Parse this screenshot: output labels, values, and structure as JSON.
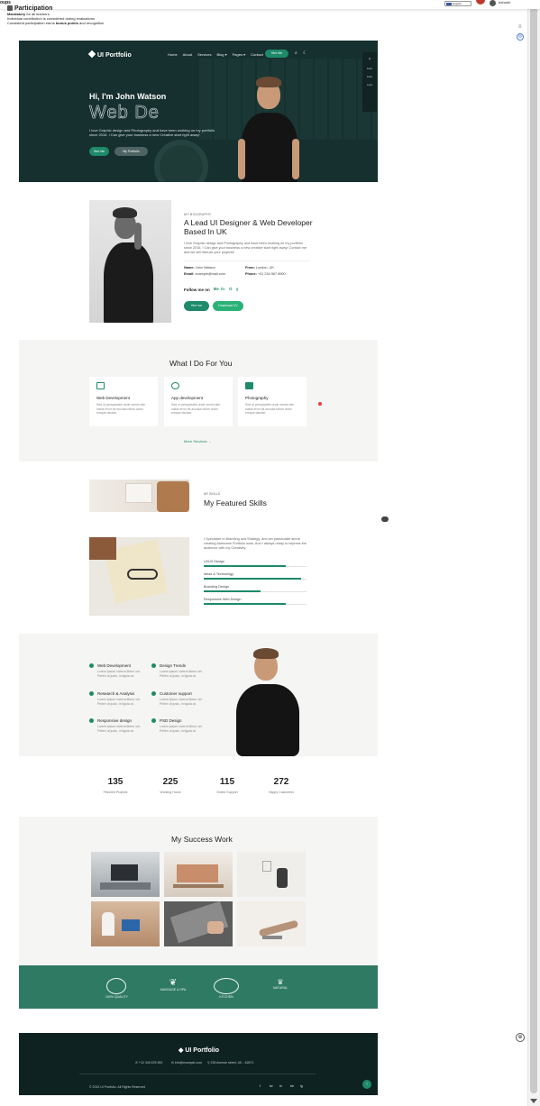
{
  "topbar": {
    "title": "oups",
    "language": "English",
    "user": "bahadir"
  },
  "intro": {
    "heading": "Participation",
    "line1_bold": "Mandatory",
    "line1_rest": " for all learners",
    "line2": "Individual contribution is considered during evaluations",
    "line3_pre": "Consistent participation earns ",
    "line3_bold": "bonus points",
    "line3_post": " and recognition"
  },
  "hero": {
    "brand": "UI Portfolio",
    "nav": [
      "Home",
      "About",
      "Services",
      "Blog",
      "Pages",
      "Contact"
    ],
    "hire_button": "Hire Me",
    "side_labels": [
      "Dark",
      "Dark",
      "Light"
    ],
    "greeting": "Hi, I'm John Watson",
    "role": "Web De",
    "description": "I love Graphic design and Photography and have been working on my portfolio since 2016. I Can give your business a new Creative start right away!",
    "btn_hire": "Hire Me",
    "btn_portfolio": "My Portfolio"
  },
  "about": {
    "small": "MY BIOGRAPHY",
    "title": "A Lead UI Designer & Web Developer Based In UK",
    "description": "I love Graphic design and Photography and have been working on my portfolio since 2016. I Can give your business a new creative start right away! Contact me and we will discuss your projects!",
    "name_label": "Name:",
    "name_value": "John Watson",
    "from_label": "From:",
    "from_value": "London, UK",
    "email_label": "Email:",
    "email_value": "example@mail.com",
    "phone_label": "Phone:",
    "phone_value": "+01 234 567 8900",
    "follow": "Follow me on",
    "social": [
      "Be",
      "in",
      "O",
      "y"
    ],
    "btn_hire": "Hire me",
    "btn_cv": "Download CV"
  },
  "services": {
    "title": "What I Do For You",
    "cards": [
      {
        "title": "Web Development",
        "desc": "Sed ut perspiciatis unde omnis iste natus error sit accusa ntium dolor emque laudan."
      },
      {
        "title": "App development",
        "desc": "Sed ut perspiciatis unde omnis iste natus error sit accusa ntium dolor emque laudan."
      },
      {
        "title": "Photography",
        "desc": "Sed ut perspiciatis unde omnis iste natus error sit accusa ntium dolor emque laudan."
      }
    ],
    "more": "More Services →"
  },
  "skills": {
    "small": "MY SKILLS",
    "title": "My Featured Skills",
    "description": "I Specialize in Branding and Strategy, and am passionate about creating Awesome Portfolio work. And I always ready to impress the audience with my Creativity.",
    "items": [
      {
        "label": "UI/UX Design",
        "level": 0.8
      },
      {
        "label": "Ideas & Technology",
        "level": 0.95
      },
      {
        "label": "Branding Design",
        "level": 0.55
      },
      {
        "label": "Responsive Web Design",
        "level": 0.8
      }
    ]
  },
  "features": [
    {
      "title": "Web Development",
      "desc": "Lorem ipsum viverra libero vel. Pellen ut justo, in ligula at."
    },
    {
      "title": "Design Trends",
      "desc": "Lorem ipsum viverra libero vel. Pellen ut justo, in ligula at."
    },
    {
      "title": "Research & Analysis",
      "desc": "Lorem ipsum viverra libero vel. Pellen ut justo, in ligula at."
    },
    {
      "title": "Customer support",
      "desc": "Lorem ipsum viverra libero vel. Pellen ut justo, in ligula at."
    },
    {
      "title": "Responsive design",
      "desc": "Lorem ipsum viverra libero vel. Pellen ut justo, in ligula at."
    },
    {
      "title": "PSD Design",
      "desc": "Lorem ipsum viverra libero vel. Pellen ut justo, in ligula at."
    }
  ],
  "counters": [
    {
      "number": "135",
      "label": "Finished Projects"
    },
    {
      "number": "225",
      "label": "Working Hours"
    },
    {
      "number": "115",
      "label": "Online Support"
    },
    {
      "number": "272",
      "label": "Happy Customers"
    }
  ],
  "portfolio": {
    "title": "My Success Work"
  },
  "clients": [
    "100% QUALITY",
    "MASSAGE & SPA",
    "KITCHEN",
    "NATURAL"
  ],
  "footer": {
    "brand": "UI Portfolio",
    "phone": "+12 345 678 900",
    "email": "info@example.com",
    "address": "235 Avenue street, UK - 62671",
    "copyright": "© 2022 UI Portfolio. All Rights Reserved",
    "social": [
      "f",
      "tw",
      "in",
      "be",
      "ig"
    ]
  },
  "colors": {
    "accent": "#1e8a6a",
    "hero_bg": "#15302e",
    "footer_bg": "#0f2222",
    "clients_bg": "#2f7a62"
  }
}
